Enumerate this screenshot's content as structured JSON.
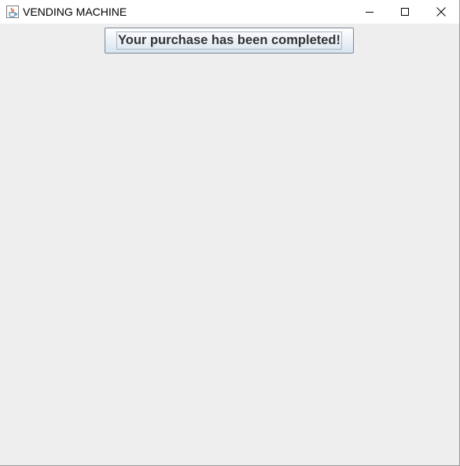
{
  "window": {
    "title": "VENDING MACHINE",
    "icon": "java-cup-icon",
    "controls": {
      "minimize": "minimize-icon",
      "maximize": "maximize-icon",
      "close": "close-icon"
    }
  },
  "main": {
    "message_button_label": "Your purchase has been completed!"
  },
  "colors": {
    "content_background": "#eeeeee",
    "titlebar_background": "#ffffff",
    "button_border": "#7a8a99",
    "button_text": "#333333"
  }
}
